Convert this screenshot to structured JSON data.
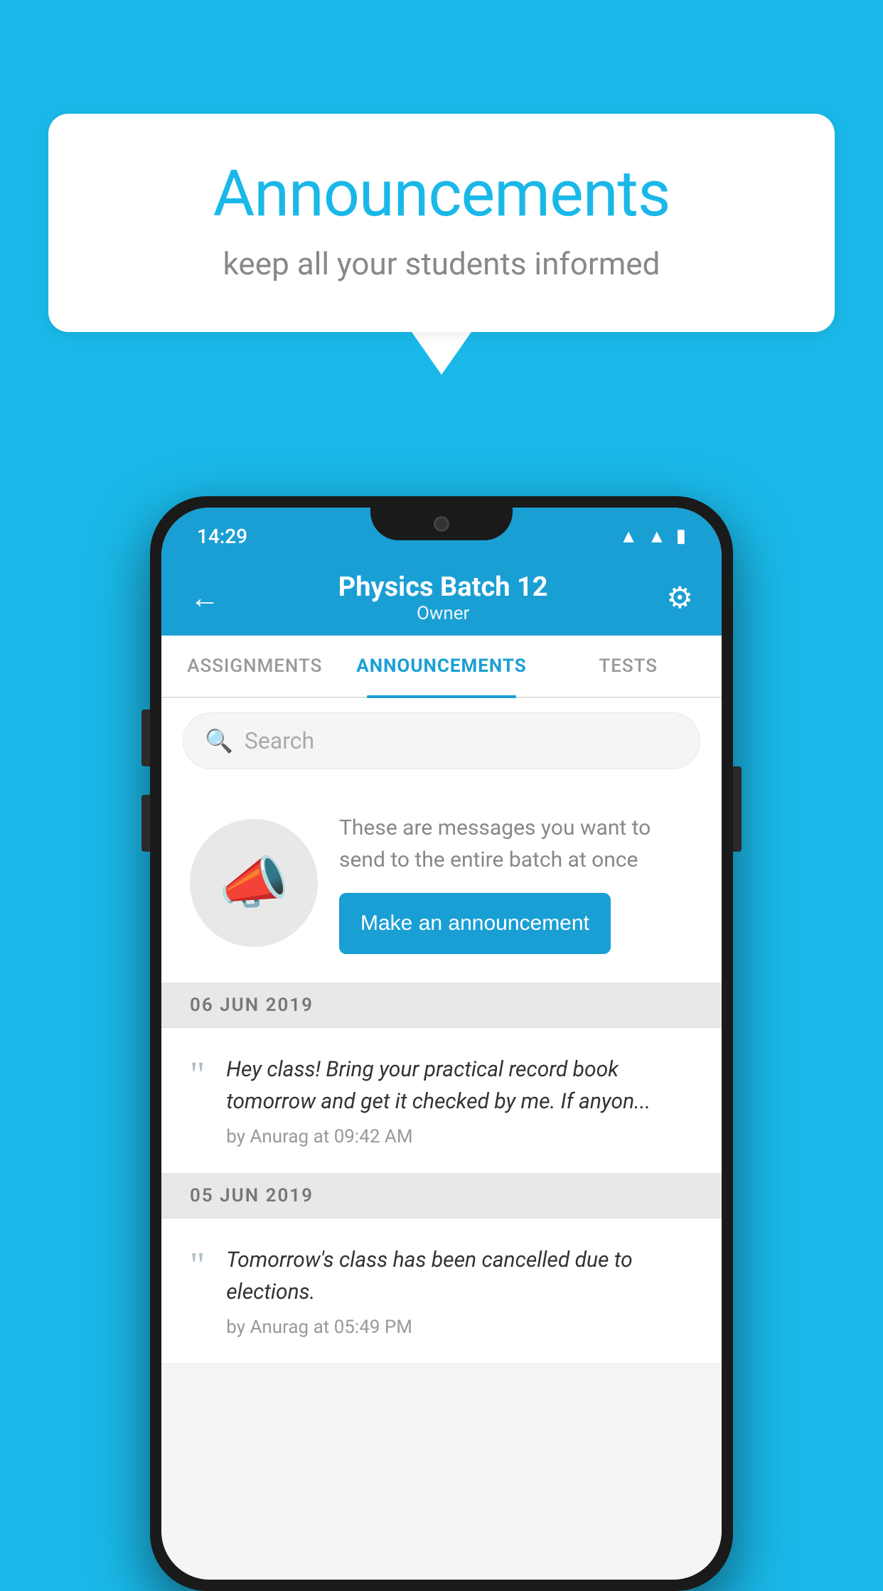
{
  "page": {
    "background_color": "#1ab8e8"
  },
  "speech_bubble": {
    "title": "Announcements",
    "subtitle": "keep all your students informed"
  },
  "phone": {
    "status_bar": {
      "time": "14:29",
      "wifi_icon": "▲",
      "signal_icon": "▲",
      "battery_icon": "▮"
    },
    "header": {
      "back_label": "←",
      "title": "Physics Batch 12",
      "subtitle": "Owner",
      "gear_label": "⚙"
    },
    "tabs": [
      {
        "label": "ASSIGNMENTS",
        "active": false
      },
      {
        "label": "ANNOUNCEMENTS",
        "active": true
      },
      {
        "label": "TESTS",
        "active": false
      }
    ],
    "search": {
      "placeholder": "Search"
    },
    "promo_card": {
      "description": "These are messages you want to send to the entire batch at once",
      "button_label": "Make an announcement"
    },
    "announcements": [
      {
        "date": "06  JUN  2019",
        "text": "Hey class! Bring your practical record book tomorrow and get it checked by me. If anyon...",
        "meta": "by Anurag at 09:42 AM"
      },
      {
        "date": "05  JUN  2019",
        "text": "Tomorrow's class has been cancelled due to elections.",
        "meta": "by Anurag at 05:49 PM"
      }
    ]
  }
}
